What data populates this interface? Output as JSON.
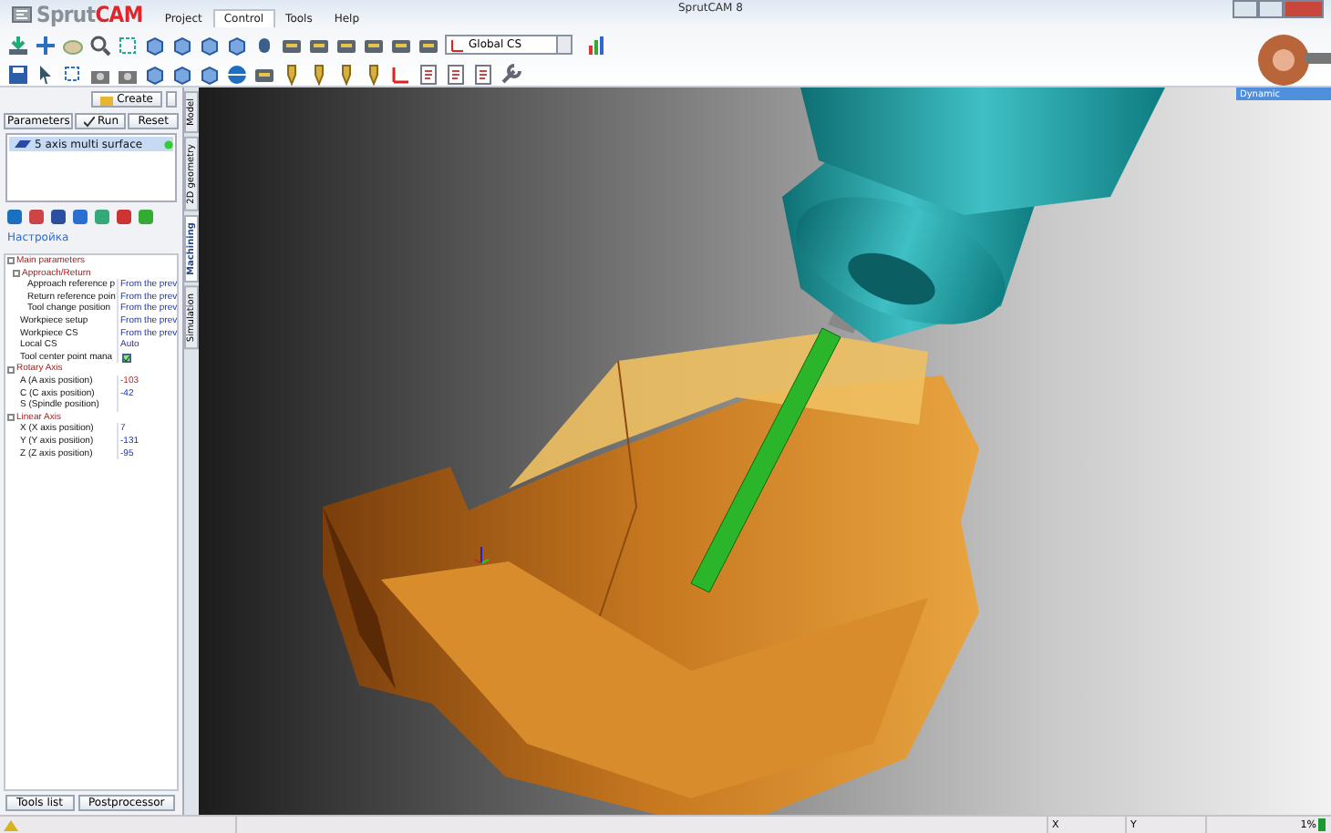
{
  "window": {
    "title": "SprutCAM 8",
    "logo": [
      "Sprut",
      "CAM"
    ]
  },
  "menu_tabs": [
    {
      "label": "Project",
      "selected": false
    },
    {
      "label": "Control",
      "selected": true
    },
    {
      "label": "Tools",
      "selected": false
    },
    {
      "label": "Help",
      "selected": false
    }
  ],
  "toolbar": {
    "cs_dropdown": "Global CS"
  },
  "left_panel": {
    "create_button": "Create",
    "buttons": [
      "Parameters",
      "Run",
      "Reset"
    ],
    "operations": [
      {
        "name": "5 axis multi surface",
        "selected": true
      }
    ],
    "settings_link": "Настройка",
    "properties": [
      {
        "label": "Main parameters",
        "children": [
          {
            "label": "Approach/Return",
            "children": [
              {
                "label": "Approach reference p",
                "kind": "text",
                "value": "From the prev",
                "highlighted": false
              },
              {
                "label": "Return reference poin",
                "kind": "text",
                "value": "From the prev",
                "highlighted": false
              },
              {
                "label": "Tool change position",
                "kind": "text",
                "value": "From the prev",
                "highlighted": false
              }
            ]
          },
          {
            "label": "Workpiece setup",
            "kind": "text",
            "value": "From the prev",
            "highlighted": false
          },
          {
            "label": "Workpiece CS",
            "kind": "text",
            "value": "From the prev",
            "highlighted": false
          },
          {
            "label": "Local CS",
            "kind": "text",
            "value": "Auto",
            "highlighted": false
          },
          {
            "label": "Tool center point mana",
            "kind": "checkbox",
            "checked": true
          }
        ]
      },
      {
        "label": "Rotary Axis",
        "children": [
          {
            "label": "A (A axis position)",
            "kind": "text",
            "value": "-103",
            "highlighted": true
          },
          {
            "label": "C (C axis position)",
            "kind": "text",
            "value": "-42",
            "highlighted": false
          },
          {
            "label": "S (Spindle position)",
            "kind": "text"
          }
        ]
      },
      {
        "label": "Linear Axis",
        "children": [
          {
            "label": "X (X axis position)",
            "kind": "text",
            "value": "7",
            "highlighted": false
          },
          {
            "label": "Y (Y axis position)",
            "kind": "text",
            "value": "-131",
            "highlighted": false
          },
          {
            "label": "Z (Z axis position)",
            "kind": "text",
            "value": "-95",
            "highlighted": false
          }
        ]
      }
    ],
    "bottom_tabs": [
      "Tools list",
      "Postprocessor"
    ]
  },
  "side_tabs": [
    {
      "label": "Model",
      "selected": false
    },
    {
      "label": "2D geometry",
      "selected": false
    },
    {
      "label": "Machining",
      "selected": true
    },
    {
      "label": "Simulation",
      "selected": false
    }
  ],
  "viewport": {
    "view_dropdown": "Dynamic"
  },
  "status_bar": {
    "x_label": "X",
    "y_label": "Y",
    "progress": "1%"
  }
}
